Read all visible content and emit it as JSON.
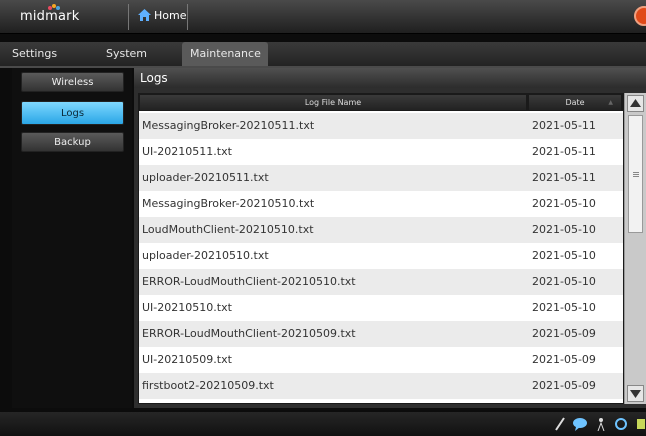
{
  "app": {
    "logo_text": "midmark"
  },
  "topbar": {
    "home_label": "Home"
  },
  "tabs": [
    {
      "label": "Settings"
    },
    {
      "label": "System"
    },
    {
      "label": "Maintenance"
    }
  ],
  "sidebar": {
    "items": [
      {
        "label": "Wireless"
      },
      {
        "label": "Logs"
      },
      {
        "label": "Backup"
      }
    ]
  },
  "panel": {
    "title": "Logs"
  },
  "table": {
    "columns": {
      "name": "Log File Name",
      "date": "Date"
    },
    "rows": [
      {
        "name": "MessagingBroker-20210511.txt",
        "date": "2021-05-11"
      },
      {
        "name": "UI-20210511.txt",
        "date": "2021-05-11"
      },
      {
        "name": "uploader-20210511.txt",
        "date": "2021-05-11"
      },
      {
        "name": "MessagingBroker-20210510.txt",
        "date": "2021-05-10"
      },
      {
        "name": "LoudMouthClient-20210510.txt",
        "date": "2021-05-10"
      },
      {
        "name": "uploader-20210510.txt",
        "date": "2021-05-10"
      },
      {
        "name": "ERROR-LoudMouthClient-20210510.txt",
        "date": "2021-05-10"
      },
      {
        "name": "UI-20210510.txt",
        "date": "2021-05-10"
      },
      {
        "name": "ERROR-LoudMouthClient-20210509.txt",
        "date": "2021-05-09"
      },
      {
        "name": "UI-20210509.txt",
        "date": "2021-05-09"
      },
      {
        "name": "firstboot2-20210509.txt",
        "date": "2021-05-09"
      }
    ]
  },
  "colors": {
    "accent": "#2aa6e6",
    "alert": "#e04a1a"
  },
  "icons": [
    "home-icon",
    "alert-icon",
    "pen-icon",
    "chat-icon",
    "person-icon",
    "network-icon"
  ]
}
